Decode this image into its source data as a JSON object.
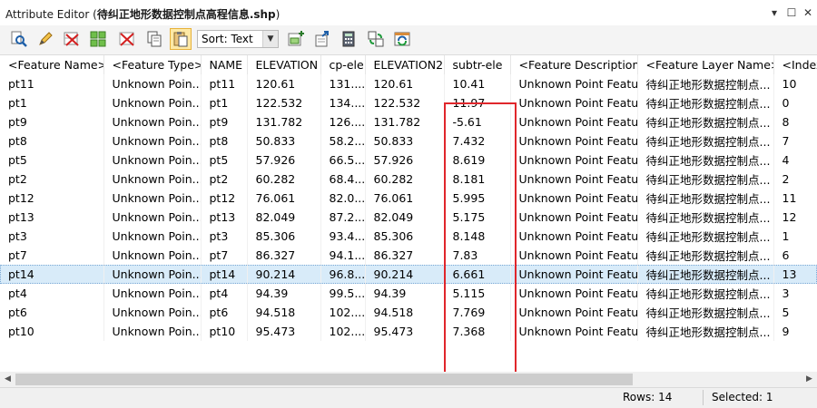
{
  "window": {
    "title_prefix": "Attribute Editor (",
    "title_name": "待纠正地形数据控制点高程信息.shp",
    "title_suffix": ")",
    "controls": [
      "▾",
      "☐",
      "✕"
    ]
  },
  "toolbar": {
    "sort_label": "Sort: Text",
    "buttons": [
      "zoom-to-feature",
      "edit-attribute",
      "delete-selected",
      "select-all",
      "clear-selection",
      "copy",
      "paste",
      "add-column",
      "export",
      "calculator",
      "refresh-link",
      "sync"
    ]
  },
  "table": {
    "columns": [
      "<Feature Name>",
      "<Feature Type>",
      "NAME",
      "ELEVATION",
      "cp-ele",
      "ELEVATION2",
      "subtr-ele",
      "<Feature Description>",
      "<Feature Layer Name>",
      "<Index>"
    ],
    "rows": [
      [
        "pt11",
        "Unknown Poin...",
        "pt11",
        "120.61",
        "131....",
        "120.61",
        "10.41",
        "Unknown Point Featu...",
        "待纠正地形数据控制点...",
        "10"
      ],
      [
        "pt1",
        "Unknown Poin...",
        "pt1",
        "122.532",
        "134....",
        "122.532",
        "11.97",
        "Unknown Point Featu...",
        "待纠正地形数据控制点...",
        "0"
      ],
      [
        "pt9",
        "Unknown Poin...",
        "pt9",
        "131.782",
        "126....",
        "131.782",
        "-5.61",
        "Unknown Point Featu...",
        "待纠正地形数据控制点...",
        "8"
      ],
      [
        "pt8",
        "Unknown Poin...",
        "pt8",
        "50.833",
        "58.2...",
        "50.833",
        "7.432",
        "Unknown Point Featu...",
        "待纠正地形数据控制点...",
        "7"
      ],
      [
        "pt5",
        "Unknown Poin...",
        "pt5",
        "57.926",
        "66.5...",
        "57.926",
        "8.619",
        "Unknown Point Featu...",
        "待纠正地形数据控制点...",
        "4"
      ],
      [
        "pt2",
        "Unknown Poin...",
        "pt2",
        "60.282",
        "68.4...",
        "60.282",
        "8.181",
        "Unknown Point Featu...",
        "待纠正地形数据控制点...",
        "2"
      ],
      [
        "pt12",
        "Unknown Poin...",
        "pt12",
        "76.061",
        "82.0...",
        "76.061",
        "5.995",
        "Unknown Point Featu...",
        "待纠正地形数据控制点...",
        "11"
      ],
      [
        "pt13",
        "Unknown Poin...",
        "pt13",
        "82.049",
        "87.2...",
        "82.049",
        "5.175",
        "Unknown Point Featu...",
        "待纠正地形数据控制点...",
        "12"
      ],
      [
        "pt3",
        "Unknown Poin...",
        "pt3",
        "85.306",
        "93.4...",
        "85.306",
        "8.148",
        "Unknown Point Featu...",
        "待纠正地形数据控制点...",
        "1"
      ],
      [
        "pt7",
        "Unknown Poin...",
        "pt7",
        "86.327",
        "94.1...",
        "86.327",
        "7.83",
        "Unknown Point Featu...",
        "待纠正地形数据控制点...",
        "6"
      ],
      [
        "pt14",
        "Unknown Poin...",
        "pt14",
        "90.214",
        "96.8...",
        "90.214",
        "6.661",
        "Unknown Point Featu...",
        "待纠正地形数据控制点...",
        "13"
      ],
      [
        "pt4",
        "Unknown Poin...",
        "pt4",
        "94.39",
        "99.5...",
        "94.39",
        "5.115",
        "Unknown Point Featu...",
        "待纠正地形数据控制点...",
        "3"
      ],
      [
        "pt6",
        "Unknown Poin...",
        "pt6",
        "94.518",
        "102....",
        "94.518",
        "7.769",
        "Unknown Point Featu...",
        "待纠正地形数据控制点...",
        "5"
      ],
      [
        "pt10",
        "Unknown Poin...",
        "pt10",
        "95.473",
        "102....",
        "95.473",
        "7.368",
        "Unknown Point Featu...",
        "待纠正地形数据控制点...",
        "9"
      ]
    ],
    "selected_row": 10,
    "highlighted_column": "subtr-ele"
  },
  "status": {
    "rows": "Rows: 14",
    "selected": "Selected: 1"
  },
  "colors": {
    "selection": "#d8ebf9",
    "highlight_box": "#e0262b"
  }
}
